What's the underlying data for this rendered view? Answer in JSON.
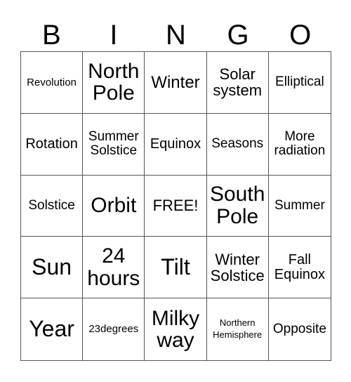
{
  "header": [
    "B",
    "I",
    "N",
    "G",
    "O"
  ],
  "cells": [
    {
      "text": "Revolution",
      "size": "s15"
    },
    {
      "text": "North Pole",
      "size": "s30"
    },
    {
      "text": "Winter",
      "size": "s24"
    },
    {
      "text": "Solar system",
      "size": "s22"
    },
    {
      "text": "Elliptical",
      "size": "s19"
    },
    {
      "text": "Rotation",
      "size": "s20"
    },
    {
      "text": "Summer Solstice",
      "size": "s19"
    },
    {
      "text": "Equinox",
      "size": "s20"
    },
    {
      "text": "Seasons",
      "size": "s19"
    },
    {
      "text": "More radiation",
      "size": "s19"
    },
    {
      "text": "Solstice",
      "size": "s19"
    },
    {
      "text": "Orbit",
      "size": "s30"
    },
    {
      "text": "FREE!",
      "size": "s22"
    },
    {
      "text": "South Pole",
      "size": "s30"
    },
    {
      "text": "Summer",
      "size": "s19"
    },
    {
      "text": "Sun",
      "size": "s32"
    },
    {
      "text": "24 hours",
      "size": "s30"
    },
    {
      "text": "Tilt",
      "size": "s32"
    },
    {
      "text": "Winter Solstice",
      "size": "s22"
    },
    {
      "text": "Fall Equinox",
      "size": "s20"
    },
    {
      "text": "Year",
      "size": "s32"
    },
    {
      "text": "23degrees",
      "size": "s15"
    },
    {
      "text": "Milky way",
      "size": "s30"
    },
    {
      "text": "Northern Hemisphere",
      "size": "s13"
    },
    {
      "text": "Opposite",
      "size": "s19"
    }
  ]
}
